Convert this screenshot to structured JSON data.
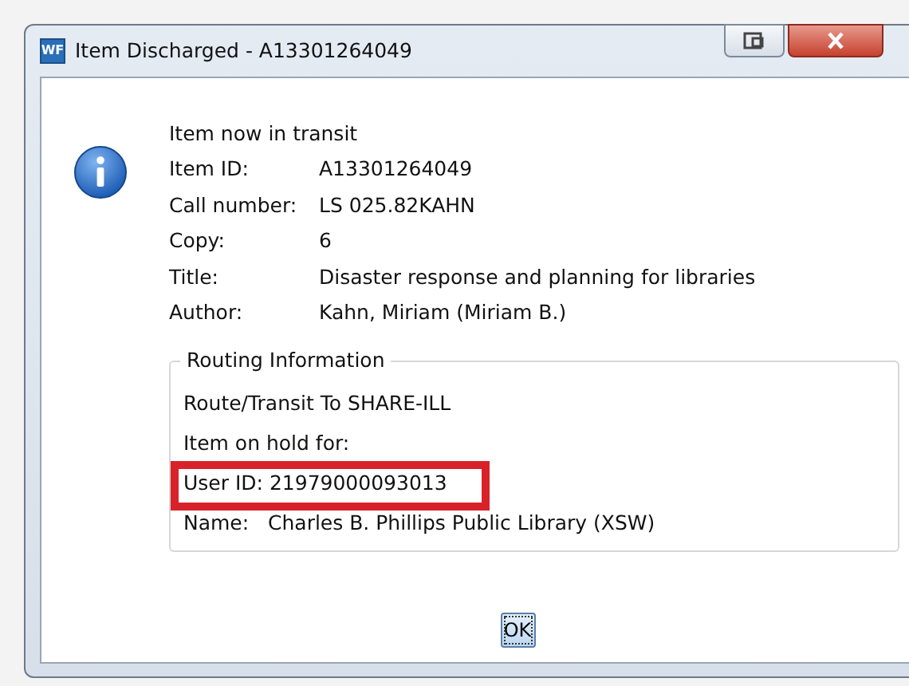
{
  "window": {
    "title": "Item Discharged - A13301264049",
    "app_badge": "WF"
  },
  "message": "Item now in transit",
  "fields": [
    {
      "label": "Item ID:",
      "value": "A13301264049"
    },
    {
      "label": "Call number:",
      "value": "LS 025.82KAHN"
    },
    {
      "label": "Copy:",
      "value": "6"
    },
    {
      "label": "Title:",
      "value": "Disaster response and planning for libraries"
    },
    {
      "label": "Author:",
      "value": "Kahn, Miriam (Miriam B.)"
    }
  ],
  "routing": {
    "title": "Routing Information",
    "lines": [
      {
        "text": "Route/Transit To SHARE-ILL",
        "highlighted": false
      },
      {
        "text": "Item on hold for:",
        "highlighted": false
      },
      {
        "text": "User ID: 21979000093013",
        "highlighted": true
      },
      {
        "text": "Name:   Charles B. Phillips Public Library (XSW)",
        "highlighted": false
      }
    ]
  },
  "buttons": [
    {
      "label": "OK",
      "focused": true
    }
  ]
}
